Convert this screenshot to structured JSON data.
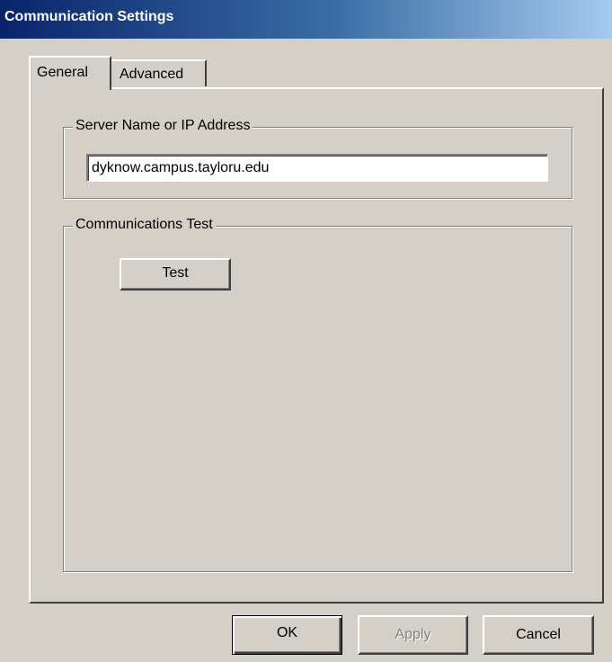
{
  "window": {
    "title": "Communication Settings"
  },
  "tabs": [
    {
      "label": "General",
      "selected": true
    },
    {
      "label": "Advanced",
      "selected": false
    }
  ],
  "server_group": {
    "legend": "Server Name or IP Address",
    "server_value": "dyknow.campus.tayloru.edu"
  },
  "test_group": {
    "legend": "Communications Test",
    "test_button": "Test"
  },
  "buttons": {
    "ok": "OK",
    "apply": "Apply",
    "cancel": "Cancel"
  },
  "colors": {
    "face": "#d4d0c8",
    "title_start": "#0a246a",
    "title_end": "#a6caf0"
  }
}
